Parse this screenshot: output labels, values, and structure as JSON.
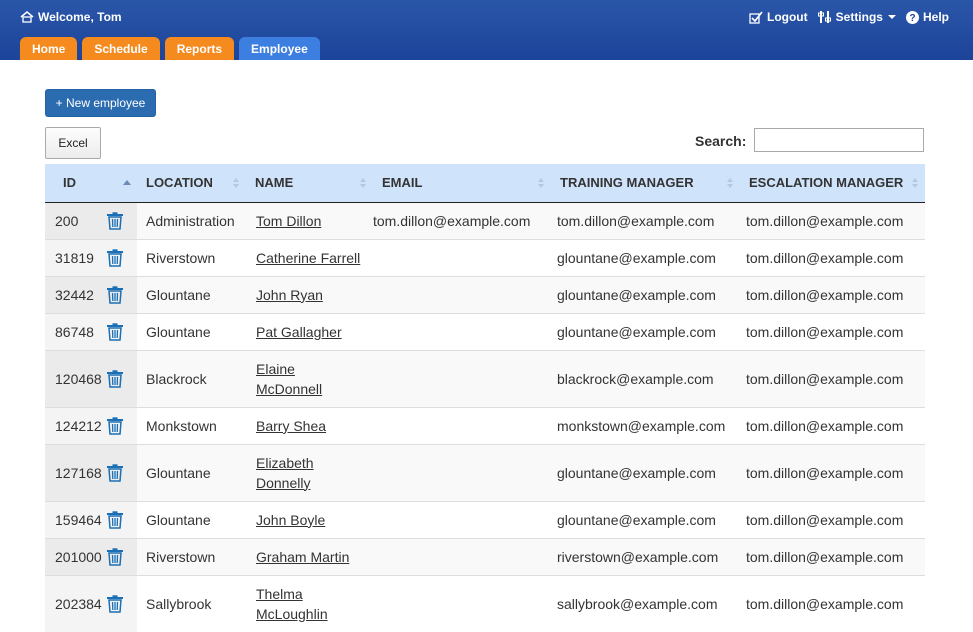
{
  "header": {
    "welcome": "Welcome, Tom",
    "logout": "Logout",
    "settings": "Settings",
    "help": "Help"
  },
  "tabs": [
    {
      "label": "Home",
      "active": false
    },
    {
      "label": "Schedule",
      "active": false
    },
    {
      "label": "Reports",
      "active": false
    },
    {
      "label": "Employee",
      "active": true
    }
  ],
  "actions": {
    "new_employee": "+ New employee",
    "excel": "Excel",
    "search_label": "Search:",
    "search_value": ""
  },
  "table": {
    "columns": [
      "ID",
      "LOCATION",
      "NAME",
      "EMAIL",
      "TRAINING MANAGER",
      "ESCALATION MANAGER"
    ],
    "rows": [
      {
        "id": "200",
        "location": "Administration",
        "name_lines": [
          "Tom Dillon"
        ],
        "email": "tom.dillon@example.com",
        "training": "tom.dillon@example.com",
        "escalation": "tom.dillon@example.com"
      },
      {
        "id": "31819",
        "location": "Riverstown",
        "name_lines": [
          "Catherine Farrell"
        ],
        "email": "",
        "training": "glountane@example.com",
        "escalation": "tom.dillon@example.com"
      },
      {
        "id": "32442",
        "location": "Glountane",
        "name_lines": [
          "John Ryan"
        ],
        "email": "",
        "training": "glountane@example.com",
        "escalation": "tom.dillon@example.com"
      },
      {
        "id": "86748",
        "location": "Glountane",
        "name_lines": [
          "Pat Gallagher"
        ],
        "email": "",
        "training": "glountane@example.com",
        "escalation": "tom.dillon@example.com"
      },
      {
        "id": "120468",
        "location": "Blackrock",
        "name_lines": [
          "Elaine",
          "McDonnell"
        ],
        "email": "",
        "training": "blackrock@example.com",
        "escalation": "tom.dillon@example.com"
      },
      {
        "id": "124212",
        "location": "Monkstown",
        "name_lines": [
          "Barry Shea"
        ],
        "email": "",
        "training": "monkstown@example.com",
        "escalation": "tom.dillon@example.com"
      },
      {
        "id": "127168",
        "location": "Glountane",
        "name_lines": [
          "Elizabeth",
          "Donnelly"
        ],
        "email": "",
        "training": "glountane@example.com",
        "escalation": "tom.dillon@example.com"
      },
      {
        "id": "159464",
        "location": "Glountane",
        "name_lines": [
          "John Boyle"
        ],
        "email": "",
        "training": "glountane@example.com",
        "escalation": "tom.dillon@example.com"
      },
      {
        "id": "201000",
        "location": "Riverstown",
        "name_lines": [
          "Graham Martin"
        ],
        "email": "",
        "training": "riverstown@example.com",
        "escalation": "tom.dillon@example.com"
      },
      {
        "id": "202384",
        "location": "Sallybrook",
        "name_lines": [
          "Thelma",
          "McLoughlin"
        ],
        "email": "",
        "training": "sallybrook@example.com",
        "escalation": "tom.dillon@example.com"
      }
    ]
  },
  "colors": {
    "header_bg": "#1c449a",
    "tab_orange": "#f58a1f",
    "tab_active": "#3d7fe0",
    "button_blue": "#2b6cb0",
    "table_header": "#cfe3fb",
    "icon_blue": "#1a6fb5"
  }
}
